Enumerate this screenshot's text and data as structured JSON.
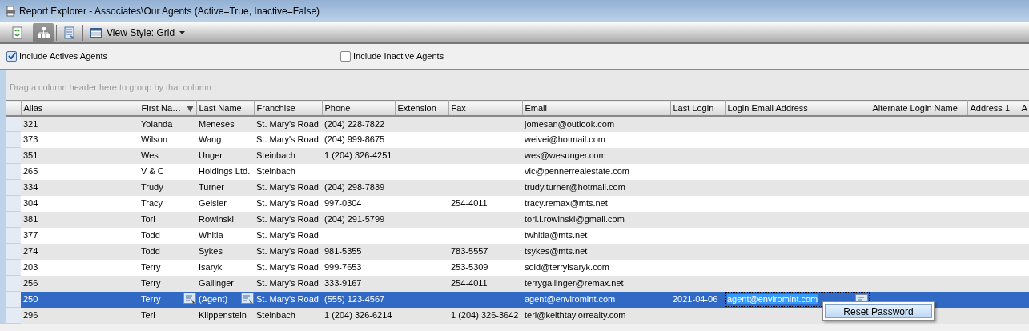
{
  "window": {
    "title": "Report Explorer - Associates\\Our Agents (Active=True, Inactive=False)"
  },
  "toolbar": {
    "buttons": [
      {
        "pressed": false
      },
      {
        "pressed": true
      },
      {
        "pressed": false
      }
    ],
    "view_style": {
      "label": "View Style: Grid"
    }
  },
  "filters": [
    {
      "label": "Include Actives Agents",
      "checked": true
    },
    {
      "label": "Include Inactive Agents",
      "checked": false
    }
  ],
  "group_panel": {
    "hint": "Drag a column header here to group by that column"
  },
  "table": {
    "columns": [
      {
        "label": "Alias"
      },
      {
        "label": "First Na…",
        "sorted_descending": true
      },
      {
        "label": "Last Name"
      },
      {
        "label": "Franchise"
      },
      {
        "label": "Phone"
      },
      {
        "label": "Extension"
      },
      {
        "label": "Fax"
      },
      {
        "label": "Email"
      },
      {
        "label": "Last Login"
      },
      {
        "label": "Login Email Address"
      },
      {
        "label": "Alternate Login Name"
      },
      {
        "label": "Address 1"
      },
      {
        "label": "A"
      }
    ],
    "rows": [
      {
        "selected": false,
        "alias": "321",
        "first_name": "Yolanda",
        "last_name": "Meneses",
        "franchise": "St. Mary's Road",
        "phone": "(204) 228-7822",
        "email": "jomesan@outlook.com"
      },
      {
        "selected": false,
        "alias": "373",
        "first_name": "Wilson",
        "last_name": "Wang",
        "franchise": "St. Mary's Road",
        "phone": "(204) 999-8675",
        "email": "weivei@hotmail.com"
      },
      {
        "selected": false,
        "alias": "351",
        "first_name": "Wes",
        "last_name": "Unger",
        "franchise": "Steinbach",
        "phone": "1 (204) 326-4251",
        "email": "wes@wesunger.com"
      },
      {
        "selected": false,
        "alias": "265",
        "first_name": "V & C",
        "last_name": "Holdings Ltd.",
        "franchise": "Steinbach",
        "email": "vic@pennerrealestate.com"
      },
      {
        "selected": false,
        "alias": "334",
        "first_name": "Trudy",
        "last_name": "Turner",
        "franchise": "St. Mary's Road",
        "phone": "(204) 298-7839",
        "email": "trudy.turner@hotmail.com"
      },
      {
        "selected": false,
        "alias": "304",
        "first_name": "Tracy",
        "last_name": "Geisler",
        "franchise": "St. Mary's Road",
        "phone": "997-0304",
        "fax": "254-4011",
        "email": "tracy.remax@mts.net"
      },
      {
        "selected": false,
        "alias": "381",
        "first_name": "Tori",
        "last_name": "Rowinski",
        "franchise": "St. Mary's Road",
        "phone": "(204) 291-5799",
        "email": "tori.l.rowinski@gmail.com"
      },
      {
        "selected": false,
        "alias": "377",
        "first_name": "Todd",
        "last_name": "Whitla",
        "franchise": "St. Mary's Road",
        "email": "twhitla@mts.net"
      },
      {
        "selected": false,
        "alias": "274",
        "first_name": "Todd",
        "last_name": "Sykes",
        "franchise": "St. Mary's Road",
        "phone": "981-5355",
        "fax": "783-5557",
        "email": "tsykes@mts.net"
      },
      {
        "selected": false,
        "alias": "203",
        "first_name": "Terry",
        "last_name": "Isaryk",
        "franchise": "St. Mary's Road",
        "phone": "999-7653",
        "fax": "253-5309",
        "email": "sold@terryisaryk.com"
      },
      {
        "selected": false,
        "alias": "256",
        "first_name": "Terry",
        "last_name": "Gallinger",
        "franchise": "St. Mary's Road",
        "phone": "333-9167",
        "fax": "254-4011",
        "email": "terrygallinger@remax.net"
      },
      {
        "selected": true,
        "editing": true,
        "alias": "250",
        "first_name": "Terry",
        "last_name": "(Agent)",
        "franchise": "St. Mary's Road",
        "phone": "(555) 123-4567",
        "email": "agent@enviromint.com",
        "last_login": "2021-04-06",
        "login_email": "agent@enviromint.com"
      },
      {
        "selected": false,
        "alias": "296",
        "first_name": "Teri",
        "last_name": "Klippenstein",
        "franchise": "Steinbach",
        "phone": "1 (204) 326-6214",
        "fax": "1 (204) 326-3642",
        "email": "teri@keithtaylorrealty.com"
      }
    ]
  },
  "context_menu": {
    "items": [
      {
        "label": "Reset Password"
      }
    ]
  }
}
